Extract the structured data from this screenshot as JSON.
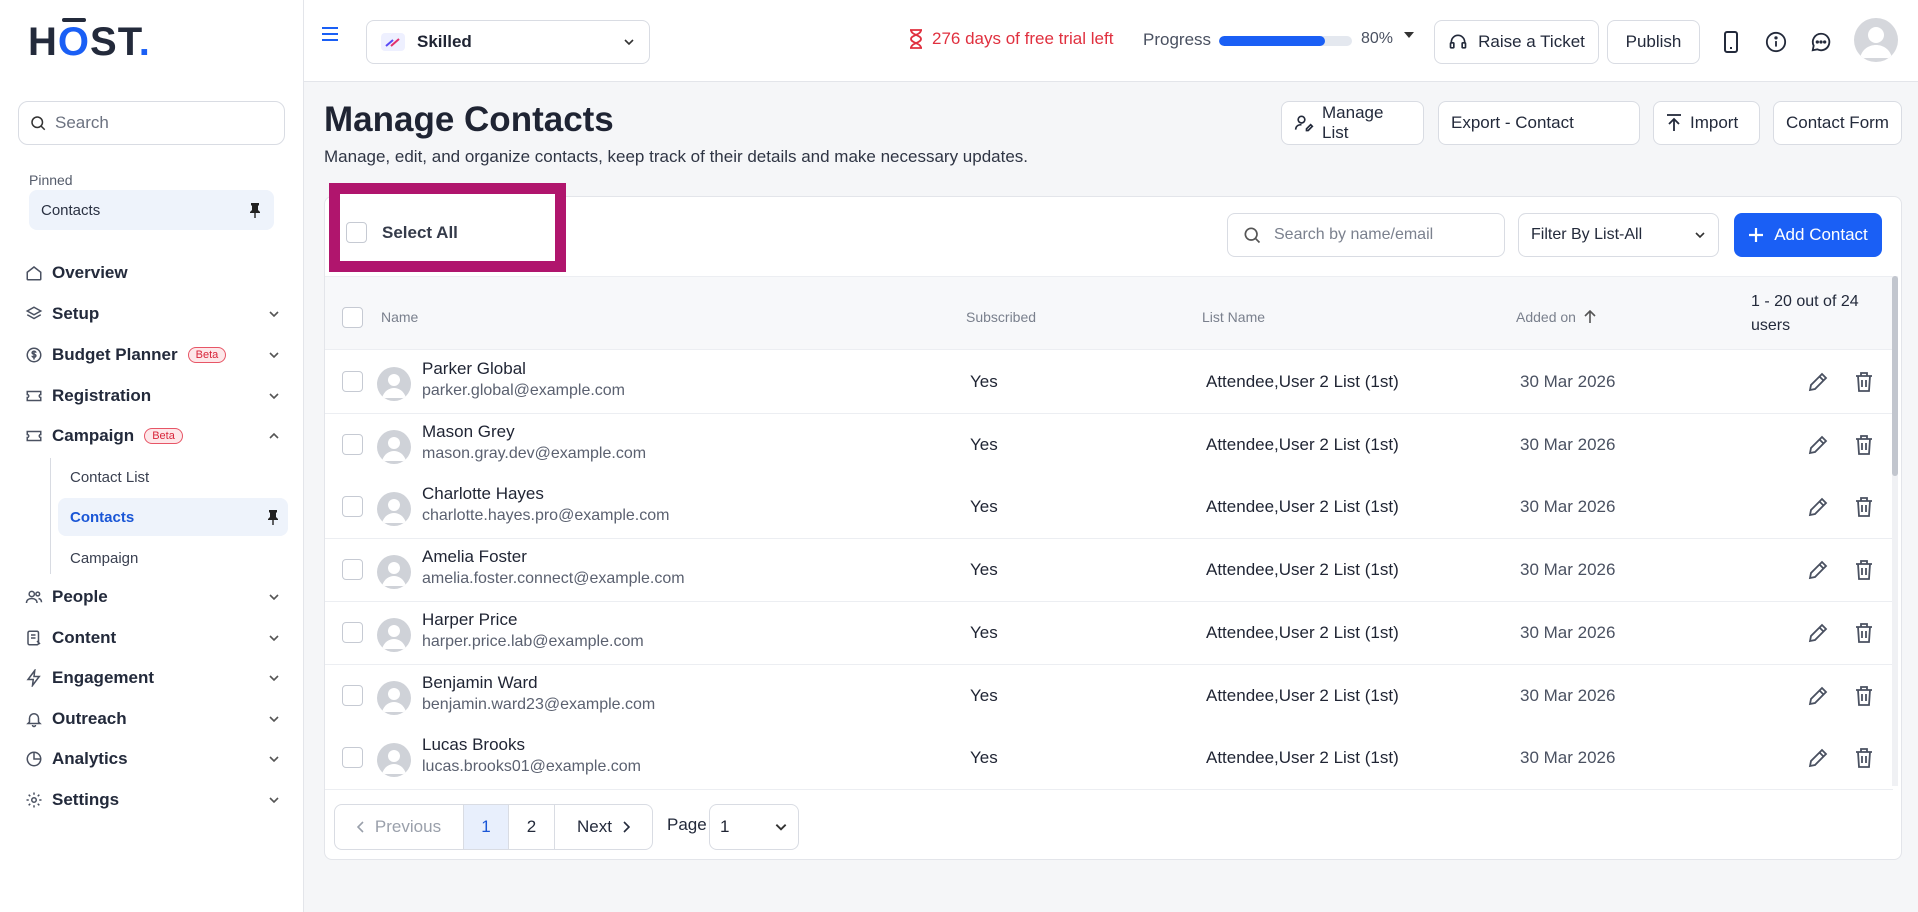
{
  "brand": {
    "logo_h": "H",
    "logo_o": "O",
    "logo_st": "ST",
    "logo_dot": "."
  },
  "sidebar": {
    "search_placeholder": "Search",
    "pinned_label": "Pinned",
    "pinned_item": "Contacts",
    "items": [
      {
        "label": "Overview",
        "icon": "home-icon"
      },
      {
        "label": "Setup",
        "icon": "layers-icon"
      },
      {
        "label": "Budget Planner",
        "icon": "dollar-icon",
        "badge": "Beta"
      },
      {
        "label": "Registration",
        "icon": "ticket-icon"
      },
      {
        "label": "Campaign",
        "icon": "ticket-icon",
        "badge": "Beta"
      },
      {
        "label": "People",
        "icon": "people-icon"
      },
      {
        "label": "Content",
        "icon": "content-icon"
      },
      {
        "label": "Engagement",
        "icon": "bolt-icon"
      },
      {
        "label": "Outreach",
        "icon": "bell-icon"
      },
      {
        "label": "Analytics",
        "icon": "pie-icon"
      },
      {
        "label": "Settings",
        "icon": "gear-icon"
      }
    ],
    "sub_items": [
      "Contact List",
      "Contacts",
      "Campaign"
    ]
  },
  "topbar": {
    "event_name": "Skilled",
    "trial_text": "276 days of free trial left",
    "progress_label": "Progress",
    "progress_value": 80,
    "progress_pct": "80%",
    "raise_ticket": "Raise a Ticket",
    "publish": "Publish"
  },
  "main": {
    "title": "Manage Contacts",
    "subtitle": "Manage, edit, and organize contacts, keep track of their details and make necessary updates.",
    "actions": {
      "manage_list": "Manage List",
      "export": "Export - Contact",
      "import": "Import",
      "contact_form": "Contact Form"
    },
    "select_all": "Select All",
    "search_placeholder": "Search by name/email",
    "filter": "Filter By List-All",
    "add_contact": "Add Contact",
    "columns": {
      "name": "Name",
      "subscribed": "Subscribed",
      "list_name": "List Name",
      "added_on": "Added on"
    },
    "count_text": "1 - 20 out of 24 users",
    "rows": [
      {
        "name": "Parker Global",
        "email": "parker.global@example.com",
        "subscribed": "Yes",
        "list": "Attendee,User 2 List (1st)",
        "date": "30 Mar 2026"
      },
      {
        "name": "Mason Grey",
        "email": "mason.gray.dev@example.com",
        "subscribed": "Yes",
        "list": "Attendee,User 2 List (1st)",
        "date": "30 Mar 2026"
      },
      {
        "name": "Charlotte Hayes",
        "email": "charlotte.hayes.pro@example.com",
        "subscribed": "Yes",
        "list": "Attendee,User 2 List (1st)",
        "date": "30 Mar 2026"
      },
      {
        "name": "Amelia Foster",
        "email": "amelia.foster.connect@example.com",
        "subscribed": "Yes",
        "list": "Attendee,User 2 List (1st)",
        "date": "30 Mar 2026"
      },
      {
        "name": "Harper Price",
        "email": "harper.price.lab@example.com",
        "subscribed": "Yes",
        "list": "Attendee,User 2 List (1st)",
        "date": "30 Mar 2026"
      },
      {
        "name": "Benjamin Ward",
        "email": "benjamin.ward23@example.com",
        "subscribed": "Yes",
        "list": "Attendee,User 2 List (1st)",
        "date": "30 Mar 2026"
      },
      {
        "name": "Lucas Brooks",
        "email": "lucas.brooks01@example.com",
        "subscribed": "Yes",
        "list": "Attendee,User 2 List (1st)",
        "date": "30 Mar 2026"
      }
    ],
    "pagination": {
      "previous": "Previous",
      "pages": [
        "1",
        "2"
      ],
      "next": "Next",
      "page_label": "Page",
      "current_page": "1"
    }
  },
  "colors": {
    "accent": "#1a5ff5",
    "highlight": "#b0156d",
    "trial": "#e0303f"
  }
}
